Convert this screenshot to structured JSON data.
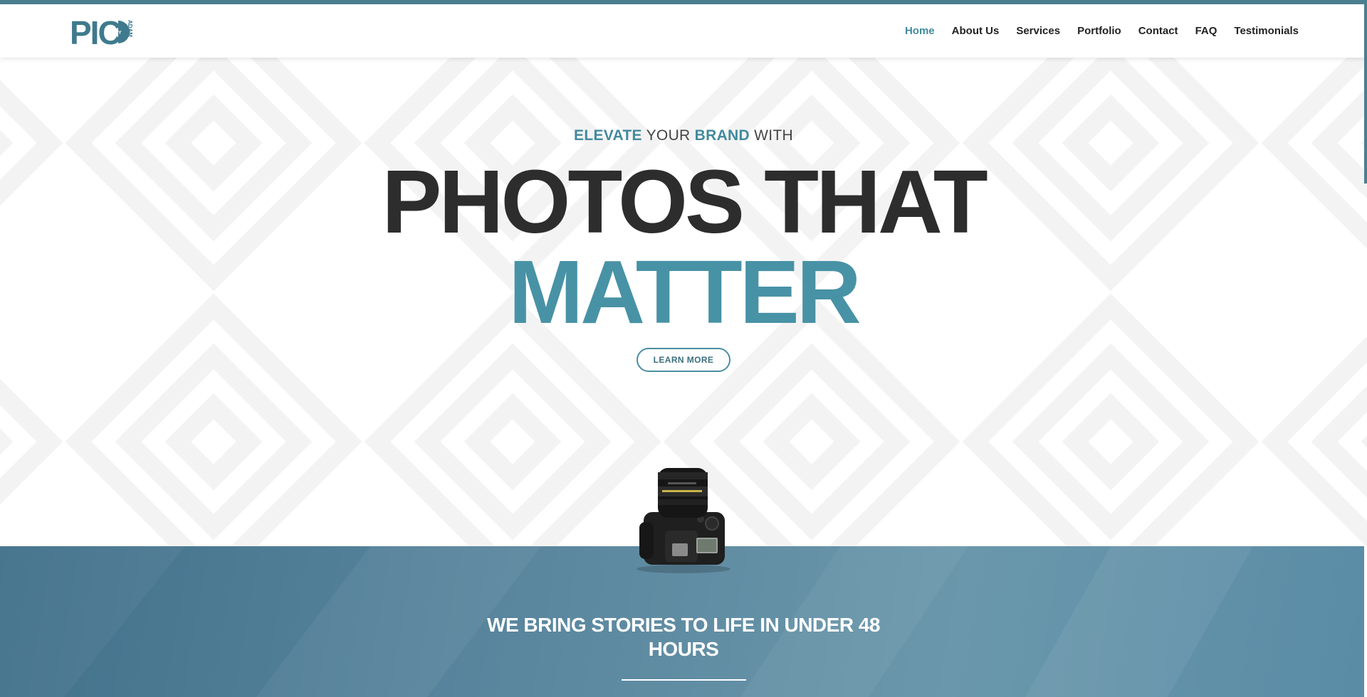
{
  "header": {
    "logo": {
      "text": "PIC",
      "small_by": "BY",
      "small_name": "ADAM"
    },
    "nav": [
      {
        "label": "Home",
        "active": true
      },
      {
        "label": "About Us",
        "active": false
      },
      {
        "label": "Services",
        "active": false
      },
      {
        "label": "Portfolio",
        "active": false
      },
      {
        "label": "Contact",
        "active": false
      },
      {
        "label": "FAQ",
        "active": false
      },
      {
        "label": "Testimonials",
        "active": false
      }
    ]
  },
  "hero": {
    "eyebrow": {
      "w1": "ELEVATE",
      "w2": "YOUR",
      "w3": "BRAND",
      "w4": "WITH"
    },
    "headline_line1": "PHOTOS THAT",
    "headline_line2": "MATTER",
    "cta_label": "LEARN MORE"
  },
  "band": {
    "title": "WE BRING STORIES TO LIFE IN UNDER 48 HOURS"
  },
  "colors": {
    "accent": "#4892a6",
    "nav_active": "#3f8b9c",
    "headline_dark": "#2d2d2d",
    "band_blue": "#5a8ca6",
    "top_bar": "#4a7f8f"
  },
  "icons": {
    "camera": "camera-image"
  }
}
